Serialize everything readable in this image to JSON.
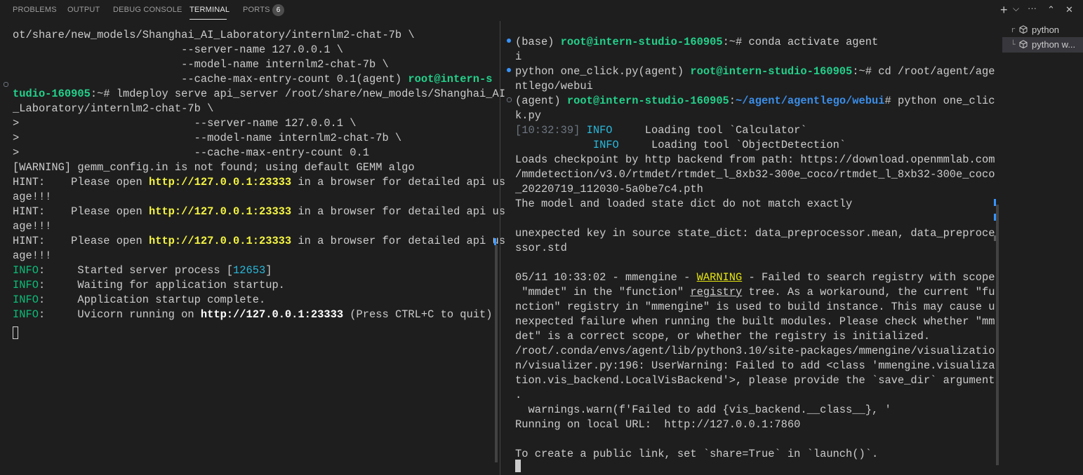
{
  "panel_tabs": {
    "problems": "PROBLEMS",
    "output": "OUTPUT",
    "debug_console": "DEBUG CONSOLE",
    "terminal": "TERMINAL",
    "ports": "PORTS",
    "ports_count": "6"
  },
  "toolbar_icons": {
    "add": "+",
    "add_dropdown": "⌵",
    "more": "···",
    "maximize": "⌃",
    "close": "✕"
  },
  "left": {
    "l1": "ot/share/new_models/Shanghai_AI_Laboratory/internlm2-chat-7b \\",
    "l2": "                          --server-name 127.0.0.1 \\",
    "l3": "                          --model-name internlm2-chat-7b \\",
    "l4a": "                          --cache-max-entry-count 0.1(agent) ",
    "l4b": "root@intern-s",
    "l5a": "tudio-160905",
    "l5b": ":~# lmdeploy serve api_server /root/share/new_models/Shanghai_AI",
    "l6": "_Laboratory/internlm2-chat-7b \\",
    "l7": ">                           --server-name 127.0.0.1 \\",
    "l8": ">                           --model-name internlm2-chat-7b \\",
    "l9": ">                           --cache-max-entry-count 0.1",
    "l10": "[WARNING] gemm_config.in is not found; using default GEMM algo",
    "hint_prefix": "HINT:    Please open ",
    "hint_url": "http://127.0.0.1:23333",
    "hint_suffix": " in a browser for detailed api us",
    "hint_cont": "age!!!",
    "info": "INFO",
    "info1a": ":     Started server process [",
    "info1b": "12653",
    "info1c": "]",
    "info2": ":     Waiting for application startup.",
    "info3": ":     Application startup complete.",
    "info4a": ":     Uvicorn running on ",
    "info4b": "http://127.0.0.1:23333",
    "info4c": " (Press CTRL+C to quit)"
  },
  "right": {
    "r1a": "(base) ",
    "r1b": "root@intern-studio-160905",
    "r1c": ":~# conda activate agent",
    "r2": "i",
    "r3a": "python one_click.py(agent) ",
    "r3b": "root@intern-studio-160905",
    "r3c": ":~# cd /root/agent/age",
    "r4": "ntlego/webui",
    "r5a": "(agent) ",
    "r5b": "root@intern-studio-160905",
    "r5c": ":",
    "r5d": "~/agent/agentlego/webui",
    "r5e": "# python one_clic",
    "r6": "k.py",
    "r7a": "[10:32:39]",
    "r7b": " INFO",
    "r7c": "     Loading tool `Calculator`",
    "r8a": "           ",
    "r8b": " INFO",
    "r8c": "     Loading tool `ObjectDetection`",
    "r9": "Loads checkpoint by http backend from path: https://download.openmmlab.com",
    "r10": "/mmdetection/v3.0/rtmdet/rtmdet_l_8xb32-300e_coco/rtmdet_l_8xb32-300e_coco",
    "r11": "_20220719_112030-5a0be7c4.pth",
    "r12": "The model and loaded state dict do not match exactly",
    "r14": "unexpected key in source state_dict: data_preprocessor.mean, data_preproce",
    "r15": "ssor.std",
    "r17a": "05/11 10:33:02 - mmengine - ",
    "r17b": "WARNING",
    "r17c": " - Failed to search registry with scope",
    "r18a": " \"mmdet\" in the \"function\" ",
    "r18b": "registry",
    "r18c": " tree. As a workaround, the current \"fu",
    "r19": "nction\" registry in \"mmengine\" is used to build instance. This may cause u",
    "r20": "nexpected failure when running the built modules. Please check whether \"mm",
    "r21": "det\" is a correct scope, or whether the registry is initialized.",
    "r22": "/root/.conda/envs/agent/lib/python3.10/site-packages/mmengine/visualizatio",
    "r23": "n/visualizer.py:196: UserWarning: Failed to add <class 'mmengine.visualiza",
    "r24": "tion.vis_backend.LocalVisBackend'>, please provide the `save_dir` argument",
    "r25": ".",
    "r26": "  warnings.warn(f'Failed to add {vis_backend.__class__}, '",
    "r27": "Running on local URL:  http://127.0.0.1:7860",
    "r29": "To create a public link, set `share=True` in `launch()`."
  },
  "sidebar": {
    "items": [
      {
        "tree": "r",
        "label": "python"
      },
      {
        "tree": "└",
        "label": "python w..."
      }
    ]
  }
}
